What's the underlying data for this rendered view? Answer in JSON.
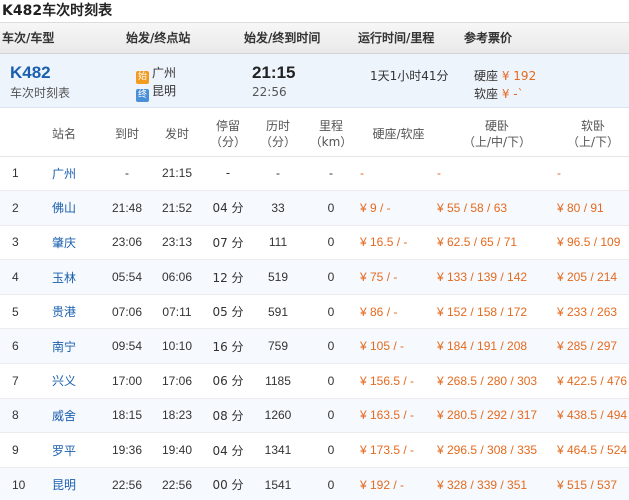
{
  "page_title": "K482车次时刻表",
  "header": {
    "col_train": "车次/车型",
    "col_stations": "始发/终点站",
    "col_times": "始发/终到时间",
    "col_duration": "运行时间/里程",
    "col_price": "参考票价"
  },
  "summary": {
    "train_code": "K482",
    "train_link": "车次时刻表",
    "start_tag": "始",
    "start_station": "广州",
    "end_tag": "终",
    "end_station": "昆明",
    "depart_time": "21:15",
    "arrive_time": "22:56",
    "duration": "1天1小时41分",
    "price_label_1": "硬座",
    "price_value_1": "¥ 192",
    "price_label_2": "软座",
    "price_value_2": "¥ -`"
  },
  "columns": {
    "station": "站名",
    "arrive": "到时",
    "depart": "发时",
    "stay_1": "停留",
    "stay_2": "（分）",
    "elapsed_1": "历时",
    "elapsed_2": "（分）",
    "distance_1": "里程",
    "distance_2": "（km）",
    "seat": "硬座/软座",
    "hard_sleeper_1": "硬卧",
    "hard_sleeper_2": "（上/中/下）",
    "soft_sleeper_1": "软卧",
    "soft_sleeper_2": "（上/下）"
  },
  "rows": [
    {
      "no": "1",
      "station": "广州",
      "arrive": "-",
      "depart": "21:15",
      "stay": "-",
      "elapsed": "-",
      "distance": "-",
      "seat": "-",
      "hard": "-",
      "soft": "-"
    },
    {
      "no": "2",
      "station": "佛山",
      "arrive": "21:48",
      "depart": "21:52",
      "stay": "04 分",
      "elapsed": "33",
      "distance": "0",
      "seat": "¥ 9 / -",
      "hard": "¥ 55 / 58 / 63",
      "soft": "¥ 80 / 91"
    },
    {
      "no": "3",
      "station": "肇庆",
      "arrive": "23:06",
      "depart": "23:13",
      "stay": "07 分",
      "elapsed": "111",
      "distance": "0",
      "seat": "¥ 16.5 / -",
      "hard": "¥ 62.5 / 65 / 71",
      "soft": "¥ 96.5 / 109"
    },
    {
      "no": "4",
      "station": "玉林",
      "arrive": "05:54",
      "depart": "06:06",
      "stay": "12 分",
      "elapsed": "519",
      "distance": "0",
      "seat": "¥ 75 / -",
      "hard": "¥ 133 / 139 / 142",
      "soft": "¥ 205 / 214"
    },
    {
      "no": "5",
      "station": "贵港",
      "arrive": "07:06",
      "depart": "07:11",
      "stay": "05 分",
      "elapsed": "591",
      "distance": "0",
      "seat": "¥ 86 / -",
      "hard": "¥ 152 / 158 / 172",
      "soft": "¥ 233 / 263"
    },
    {
      "no": "6",
      "station": "南宁",
      "arrive": "09:54",
      "depart": "10:10",
      "stay": "16 分",
      "elapsed": "759",
      "distance": "0",
      "seat": "¥ 105 / -",
      "hard": "¥ 184 / 191 / 208",
      "soft": "¥ 285 / 297"
    },
    {
      "no": "7",
      "station": "兴义",
      "arrive": "17:00",
      "depart": "17:06",
      "stay": "06 分",
      "elapsed": "1185",
      "distance": "0",
      "seat": "¥ 156.5 / -",
      "hard": "¥ 268.5 / 280 / 303",
      "soft": "¥ 422.5 / 476"
    },
    {
      "no": "8",
      "station": "威舍",
      "arrive": "18:15",
      "depart": "18:23",
      "stay": "08 分",
      "elapsed": "1260",
      "distance": "0",
      "seat": "¥ 163.5 / -",
      "hard": "¥ 280.5 / 292 / 317",
      "soft": "¥ 438.5 / 494"
    },
    {
      "no": "9",
      "station": "罗平",
      "arrive": "19:36",
      "depart": "19:40",
      "stay": "04 分",
      "elapsed": "1341",
      "distance": "0",
      "seat": "¥ 173.5 / -",
      "hard": "¥ 296.5 / 308 / 335",
      "soft": "¥ 464.5 / 524"
    },
    {
      "no": "10",
      "station": "昆明",
      "arrive": "22:56",
      "depart": "22:56",
      "stay": "00 分",
      "elapsed": "1541",
      "distance": "0",
      "seat": "¥ 192 / -",
      "hard": "¥ 328 / 339 / 351",
      "soft": "¥ 515 / 537"
    }
  ]
}
